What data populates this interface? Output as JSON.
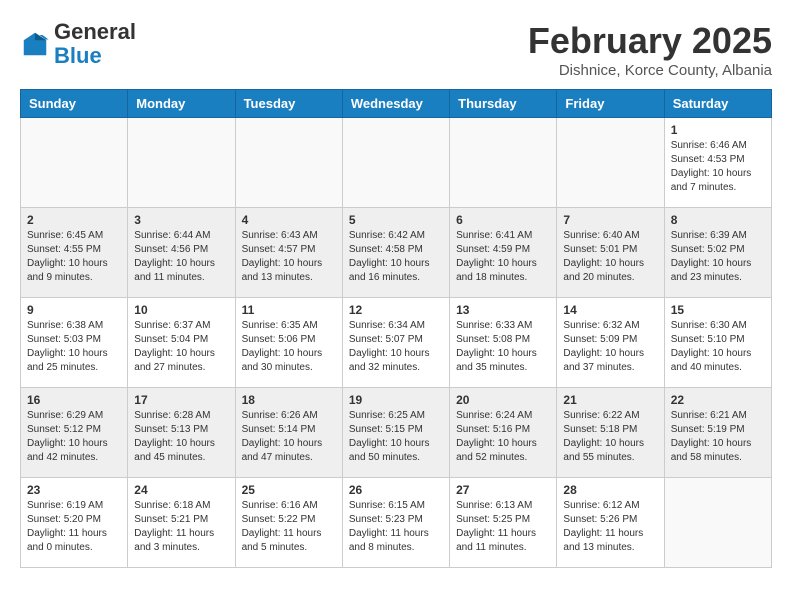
{
  "header": {
    "logo_general": "General",
    "logo_blue": "Blue",
    "title": "February 2025",
    "location": "Dishnice, Korce County, Albania"
  },
  "days_of_week": [
    "Sunday",
    "Monday",
    "Tuesday",
    "Wednesday",
    "Thursday",
    "Friday",
    "Saturday"
  ],
  "weeks": [
    [
      {
        "day": "",
        "info": ""
      },
      {
        "day": "",
        "info": ""
      },
      {
        "day": "",
        "info": ""
      },
      {
        "day": "",
        "info": ""
      },
      {
        "day": "",
        "info": ""
      },
      {
        "day": "",
        "info": ""
      },
      {
        "day": "1",
        "info": "Sunrise: 6:46 AM\nSunset: 4:53 PM\nDaylight: 10 hours and 7 minutes."
      }
    ],
    [
      {
        "day": "2",
        "info": "Sunrise: 6:45 AM\nSunset: 4:55 PM\nDaylight: 10 hours and 9 minutes."
      },
      {
        "day": "3",
        "info": "Sunrise: 6:44 AM\nSunset: 4:56 PM\nDaylight: 10 hours and 11 minutes."
      },
      {
        "day": "4",
        "info": "Sunrise: 6:43 AM\nSunset: 4:57 PM\nDaylight: 10 hours and 13 minutes."
      },
      {
        "day": "5",
        "info": "Sunrise: 6:42 AM\nSunset: 4:58 PM\nDaylight: 10 hours and 16 minutes."
      },
      {
        "day": "6",
        "info": "Sunrise: 6:41 AM\nSunset: 4:59 PM\nDaylight: 10 hours and 18 minutes."
      },
      {
        "day": "7",
        "info": "Sunrise: 6:40 AM\nSunset: 5:01 PM\nDaylight: 10 hours and 20 minutes."
      },
      {
        "day": "8",
        "info": "Sunrise: 6:39 AM\nSunset: 5:02 PM\nDaylight: 10 hours and 23 minutes."
      }
    ],
    [
      {
        "day": "9",
        "info": "Sunrise: 6:38 AM\nSunset: 5:03 PM\nDaylight: 10 hours and 25 minutes."
      },
      {
        "day": "10",
        "info": "Sunrise: 6:37 AM\nSunset: 5:04 PM\nDaylight: 10 hours and 27 minutes."
      },
      {
        "day": "11",
        "info": "Sunrise: 6:35 AM\nSunset: 5:06 PM\nDaylight: 10 hours and 30 minutes."
      },
      {
        "day": "12",
        "info": "Sunrise: 6:34 AM\nSunset: 5:07 PM\nDaylight: 10 hours and 32 minutes."
      },
      {
        "day": "13",
        "info": "Sunrise: 6:33 AM\nSunset: 5:08 PM\nDaylight: 10 hours and 35 minutes."
      },
      {
        "day": "14",
        "info": "Sunrise: 6:32 AM\nSunset: 5:09 PM\nDaylight: 10 hours and 37 minutes."
      },
      {
        "day": "15",
        "info": "Sunrise: 6:30 AM\nSunset: 5:10 PM\nDaylight: 10 hours and 40 minutes."
      }
    ],
    [
      {
        "day": "16",
        "info": "Sunrise: 6:29 AM\nSunset: 5:12 PM\nDaylight: 10 hours and 42 minutes."
      },
      {
        "day": "17",
        "info": "Sunrise: 6:28 AM\nSunset: 5:13 PM\nDaylight: 10 hours and 45 minutes."
      },
      {
        "day": "18",
        "info": "Sunrise: 6:26 AM\nSunset: 5:14 PM\nDaylight: 10 hours and 47 minutes."
      },
      {
        "day": "19",
        "info": "Sunrise: 6:25 AM\nSunset: 5:15 PM\nDaylight: 10 hours and 50 minutes."
      },
      {
        "day": "20",
        "info": "Sunrise: 6:24 AM\nSunset: 5:16 PM\nDaylight: 10 hours and 52 minutes."
      },
      {
        "day": "21",
        "info": "Sunrise: 6:22 AM\nSunset: 5:18 PM\nDaylight: 10 hours and 55 minutes."
      },
      {
        "day": "22",
        "info": "Sunrise: 6:21 AM\nSunset: 5:19 PM\nDaylight: 10 hours and 58 minutes."
      }
    ],
    [
      {
        "day": "23",
        "info": "Sunrise: 6:19 AM\nSunset: 5:20 PM\nDaylight: 11 hours and 0 minutes."
      },
      {
        "day": "24",
        "info": "Sunrise: 6:18 AM\nSunset: 5:21 PM\nDaylight: 11 hours and 3 minutes."
      },
      {
        "day": "25",
        "info": "Sunrise: 6:16 AM\nSunset: 5:22 PM\nDaylight: 11 hours and 5 minutes."
      },
      {
        "day": "26",
        "info": "Sunrise: 6:15 AM\nSunset: 5:23 PM\nDaylight: 11 hours and 8 minutes."
      },
      {
        "day": "27",
        "info": "Sunrise: 6:13 AM\nSunset: 5:25 PM\nDaylight: 11 hours and 11 minutes."
      },
      {
        "day": "28",
        "info": "Sunrise: 6:12 AM\nSunset: 5:26 PM\nDaylight: 11 hours and 13 minutes."
      },
      {
        "day": "",
        "info": ""
      }
    ]
  ]
}
